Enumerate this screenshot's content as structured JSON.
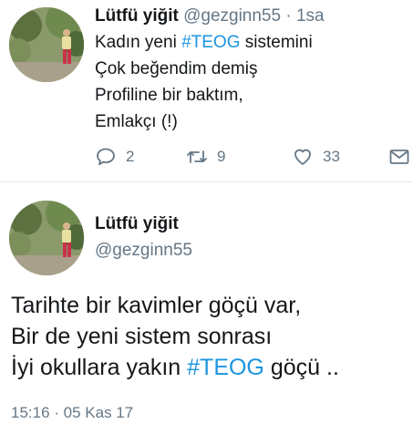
{
  "tweet1": {
    "author_name": "Lütfü yiğit",
    "author_handle": "@gezginn55",
    "separator": "·",
    "time": "1sa",
    "lines": [
      {
        "before": "Kadın yeni ",
        "hashtag": "#TEOG",
        "after": " sistemini"
      },
      {
        "text": "Çok beğendim demiş"
      },
      {
        "text": "Profiline bir baktım,"
      },
      {
        "text": "Emlakçı (!)"
      }
    ],
    "actions": {
      "reply_icon": "reply-icon",
      "reply_count": "2",
      "retweet_icon": "retweet-icon",
      "retweet_count": "9",
      "like_icon": "heart-icon",
      "like_count": "33",
      "dm_icon": "envelope-icon"
    }
  },
  "tweet2": {
    "author_name": "Lütfü yiğit",
    "author_handle": "@gezginn55",
    "lines": [
      {
        "text": "Tarihte bir kavimler göçü var,"
      },
      {
        "text": "Bir de yeni sistem sonrası"
      },
      {
        "before": "İyi okullara yakın ",
        "hashtag": "#TEOG",
        "after": " göçü .."
      }
    ],
    "timestamp": "15:16 · 05 Kas 17"
  },
  "colors": {
    "link": "#1b95e0",
    "secondary_text": "#657786",
    "primary_text": "#14171a",
    "divider": "#e1e8ed"
  }
}
